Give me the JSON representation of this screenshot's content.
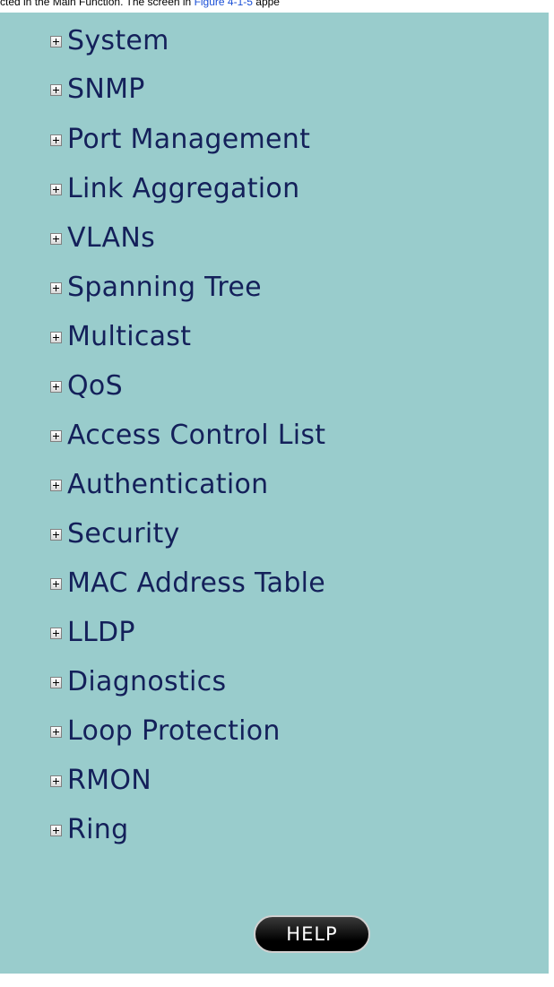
{
  "caption": {
    "prefix": "cted in the Main Function. The screen in ",
    "link": "Figure 4-1-5",
    "suffix": " appe"
  },
  "menu": {
    "items": [
      {
        "label": "System"
      },
      {
        "label": "SNMP"
      },
      {
        "label": "Port Management"
      },
      {
        "label": "Link Aggregation"
      },
      {
        "label": "VLANs"
      },
      {
        "label": "Spanning Tree"
      },
      {
        "label": "Multicast"
      },
      {
        "label": "QoS"
      },
      {
        "label": "Access Control List"
      },
      {
        "label": "Authentication"
      },
      {
        "label": "Security"
      },
      {
        "label": "MAC Address Table"
      },
      {
        "label": "LLDP"
      },
      {
        "label": "Diagnostics"
      },
      {
        "label": "Loop Protection"
      },
      {
        "label": "RMON"
      },
      {
        "label": "Ring"
      }
    ],
    "expander_icon": "plus-box-icon"
  },
  "help_button": {
    "label": "HELP"
  },
  "colors": {
    "panel_background": "#99cccc",
    "menu_text": "#14205a",
    "link": "#1a4fd6",
    "button_background": "#000000",
    "button_text": "#ffffff"
  }
}
